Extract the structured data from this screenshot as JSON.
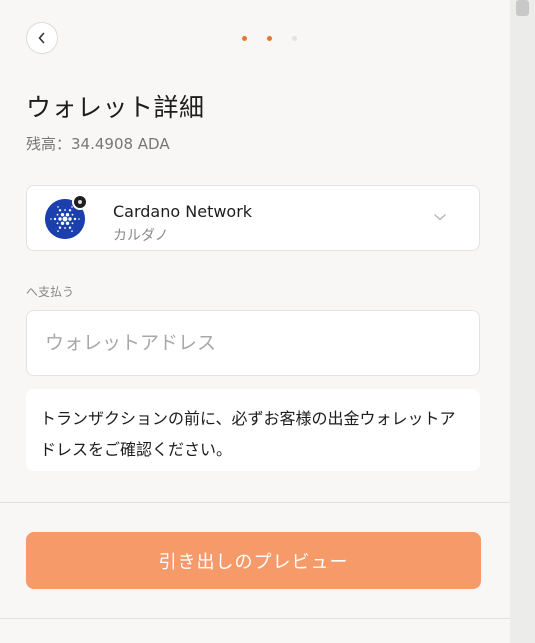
{
  "progress": {
    "total_steps": 3,
    "current_step": 2
  },
  "header": {
    "title": "ウォレット詳細",
    "balance": "残高：34.4908 ADA"
  },
  "network": {
    "name": "Cardano Network",
    "subtitle": "カルダノ"
  },
  "address": {
    "label": "へ支払う",
    "placeholder": "ウォレットアドレス",
    "value": ""
  },
  "notice": "トランザクションの前に、必ずお客様の出金ウォレットアドレスをご確認ください。",
  "preview_button": "引き出しのプレビュー",
  "colors": {
    "accent": "#e8772e",
    "button": "#f59a68",
    "cardano_blue": "#1c3fae"
  }
}
